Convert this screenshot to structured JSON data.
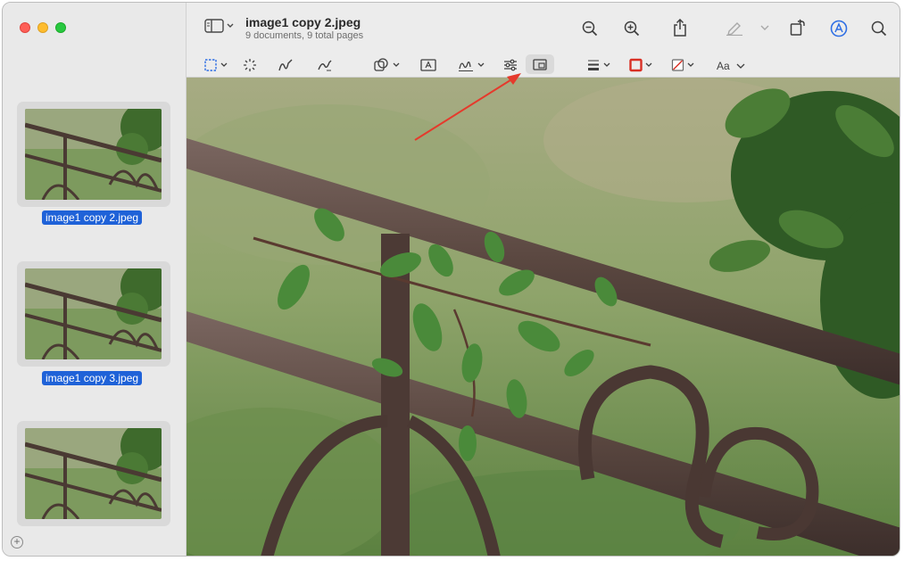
{
  "window": {
    "title": "image1 copy 2.jpeg",
    "subtitle": "9 documents, 9 total pages"
  },
  "sidebar": {
    "thumbnails": [
      {
        "label": "image1 copy 2.jpeg",
        "selected": true
      },
      {
        "label": "image1 copy 3.jpeg",
        "selected": true
      },
      {
        "label": "",
        "selected": false
      }
    ],
    "add_icon": "plus-circle-icon"
  },
  "header_icons": [
    "sidebar-toggle-icon",
    "zoom-out-icon",
    "zoom-in-icon",
    "share-icon",
    "highlighter-icon",
    "rotate-icon",
    "markup-icon",
    "search-icon"
  ],
  "markup_toolbar": {
    "text_style_label": "Aa",
    "highlighted_tool": "adjust-size-icon"
  },
  "colors": {
    "accent": "#1f62d8",
    "annotation_arrow": "#e53a2c",
    "border_color_swatch": "#d93025"
  }
}
